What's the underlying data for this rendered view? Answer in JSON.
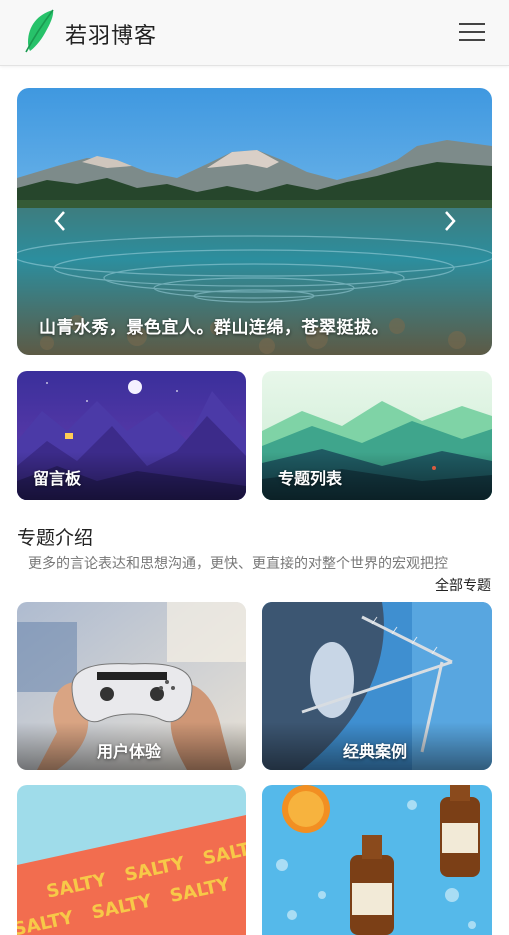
{
  "header": {
    "site_title": "若羽博客",
    "logo_icon": "feather-logo-icon",
    "menu_icon": "hamburger-menu-icon",
    "accent": "#2ecc71"
  },
  "carousel": {
    "caption": "山青水秀，景色宜人。群山连绵，苍翠挺拔。",
    "prev_icon": "chevron-left-icon",
    "next_icon": "chevron-right-icon"
  },
  "quick_links": [
    {
      "label": "留言板"
    },
    {
      "label": "专题列表"
    }
  ],
  "topics": {
    "title": "专题介绍",
    "description": "更多的言论表达和思想沟通，更快、更直接的对整个世界的宏观把控",
    "all_link": "全部专题",
    "cards": [
      {
        "label": "用户体验"
      },
      {
        "label": "经典案例"
      },
      {
        "label": ""
      },
      {
        "label": ""
      }
    ]
  },
  "illustration_text": {
    "salty": "SALTY"
  }
}
